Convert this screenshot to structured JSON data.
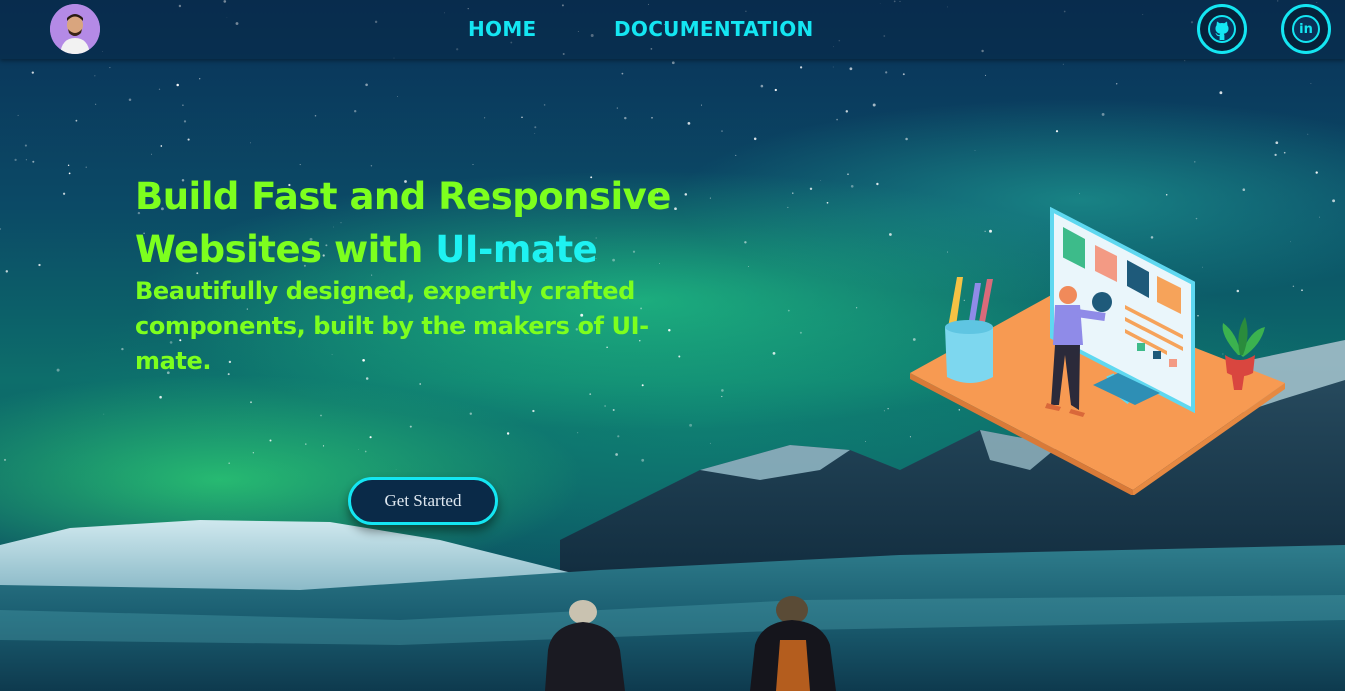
{
  "navbar": {
    "avatar_alt": "profile avatar",
    "links": [
      {
        "label": "HOME"
      },
      {
        "label": "DOCUMENTATION"
      }
    ],
    "social": {
      "github_icon": "github-icon",
      "linkedin_label": "in"
    }
  },
  "hero": {
    "title_line_1": "Build Fast and Responsive",
    "title_line_2_prefix": "Websites with ",
    "title_accent": "UI-mate",
    "subtitle": "Beautifully designed, expertly crafted components, built by the makers of UI-mate.",
    "cta_label": "Get Started"
  },
  "colors": {
    "accent_cyan": "#14e6f2",
    "headline_green": "#7dff1e",
    "button_bg": "#0a2a48"
  }
}
